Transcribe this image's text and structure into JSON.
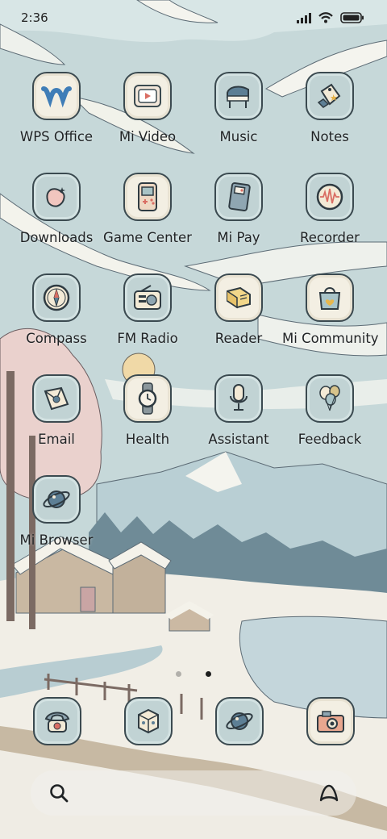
{
  "status_bar": {
    "time": "2:36"
  },
  "apps": [
    {
      "label": "WPS Office",
      "icon": "wps-office-icon"
    },
    {
      "label": "Mi Video",
      "icon": "mi-video-icon"
    },
    {
      "label": "Music",
      "icon": "music-piano-icon"
    },
    {
      "label": "Notes",
      "icon": "notes-tag-icon"
    },
    {
      "label": "Downloads",
      "icon": "downloads-icon"
    },
    {
      "label": "Game Center",
      "icon": "game-center-icon"
    },
    {
      "label": "Mi Pay",
      "icon": "mi-pay-icon"
    },
    {
      "label": "Recorder",
      "icon": "recorder-icon"
    },
    {
      "label": "Compass",
      "icon": "compass-icon"
    },
    {
      "label": "FM Radio",
      "icon": "fm-radio-icon"
    },
    {
      "label": "Reader",
      "icon": "reader-book-icon"
    },
    {
      "label": "Mi Community",
      "icon": "mi-community-bag-icon"
    },
    {
      "label": "Email",
      "icon": "email-icon"
    },
    {
      "label": "Health",
      "icon": "health-watch-icon"
    },
    {
      "label": "Assistant",
      "icon": "assistant-mic-icon"
    },
    {
      "label": "Feedback",
      "icon": "feedback-balloons-icon"
    },
    {
      "label": "Mi Browser",
      "icon": "mi-browser-planet-icon"
    }
  ],
  "dock": [
    {
      "icon": "phone-icon"
    },
    {
      "icon": "messages-icon"
    },
    {
      "icon": "browser-planet-icon"
    },
    {
      "icon": "camera-icon"
    }
  ],
  "page_indicator": {
    "pages": 2,
    "active": 1
  },
  "search_bar": {
    "left_icon": "search-icon",
    "right_icon": "assistant-a-icon"
  },
  "colors": {
    "tile_light": "#f3efe3",
    "tile_blue": "#c1d3d4",
    "outline": "#3b4a50",
    "sky": "#c9dadb"
  }
}
